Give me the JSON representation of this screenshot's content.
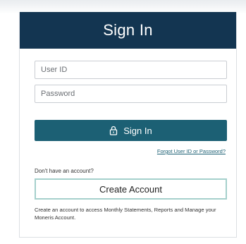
{
  "card": {
    "title": "Sign In"
  },
  "form": {
    "user_id_placeholder": "User ID",
    "password_placeholder": "Password",
    "signin_label": "Sign In",
    "forgot_link": "Forgot User ID or Password?"
  },
  "signup": {
    "prompt": "Don't have an account?",
    "create_label": "Create Account",
    "description": "Create an account to access Monthly Statements, Reports and Manage your Moneris Account."
  },
  "icons": {
    "signin_icon": "lock-icon"
  },
  "colors": {
    "header_bg": "#133551",
    "button_bg": "#1c6074",
    "create_border": "#a5d0cc"
  }
}
